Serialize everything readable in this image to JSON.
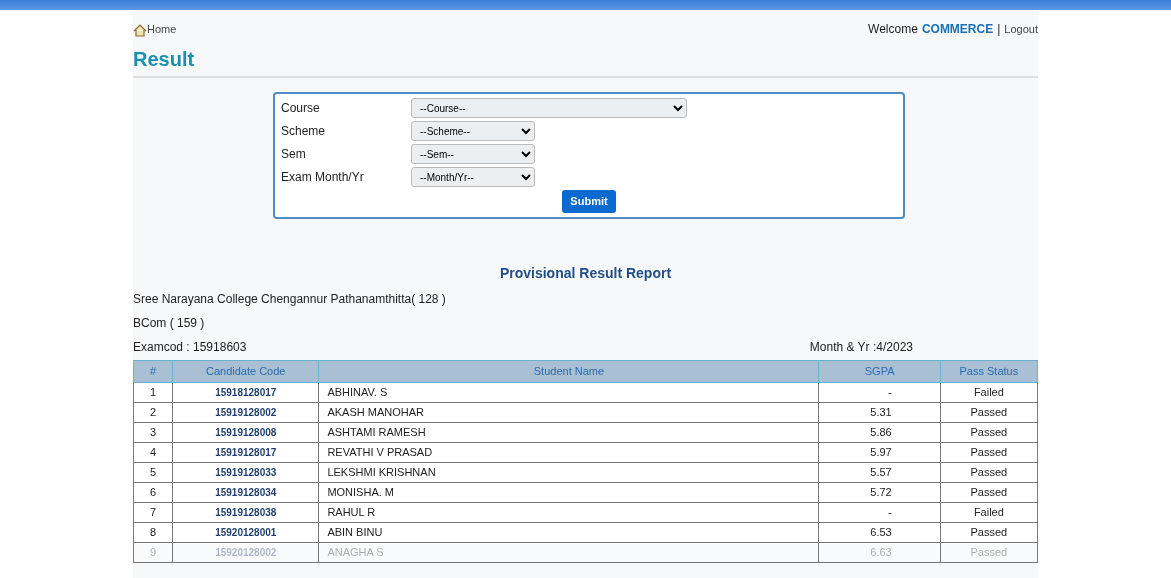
{
  "header": {
    "home_link": "Home",
    "welcome": "Welcome",
    "user": "COMMERCE",
    "separator": "|",
    "logout": "Logout"
  },
  "title": "Result",
  "form": {
    "fields": [
      {
        "label": "Course",
        "value": "--Course--",
        "wide": true
      },
      {
        "label": "Scheme",
        "value": "--Scheme--",
        "wide": false
      },
      {
        "label": "Sem",
        "value": "--Sem--",
        "wide": false
      },
      {
        "label": "Exam Month/Yr",
        "value": "--Month/Yr--",
        "wide": false
      }
    ],
    "submit": "Submit"
  },
  "report": {
    "title": "Provisional Result Report",
    "college": "Sree Narayana College Chengannur Pathanamthitta( 128 )",
    "course": "BCom ( 159 )",
    "examcode": "Examcod : 15918603",
    "month_year": "Month & Yr :4/2023"
  },
  "table": {
    "columns": [
      "#",
      "Candidate Code",
      "Student Name",
      "SGPA",
      "Pass Status"
    ],
    "rows": [
      [
        "1",
        "15918128017",
        "ABHINAV. S",
        "-",
        "Failed"
      ],
      [
        "2",
        "15919128002",
        "AKASH MANOHAR",
        "5.31",
        "Passed"
      ],
      [
        "3",
        "15919128008",
        "ASHTAMI RAMESH",
        "5.86",
        "Passed"
      ],
      [
        "4",
        "15919128017",
        "REVATHI V PRASAD",
        "5.97",
        "Passed"
      ],
      [
        "5",
        "15919128033",
        "LEKSHMI KRISHNAN",
        "5.57",
        "Passed"
      ],
      [
        "6",
        "15919128034",
        "MONISHA. M",
        "5.72",
        "Passed"
      ],
      [
        "7",
        "15919128038",
        "RAHUL R",
        "-",
        "Failed"
      ],
      [
        "8",
        "15920128001",
        "ABIN BINU",
        "6.53",
        "Passed"
      ],
      [
        "9",
        "15920128002",
        "ANAGHA S",
        "6.63",
        "Passed"
      ]
    ]
  }
}
